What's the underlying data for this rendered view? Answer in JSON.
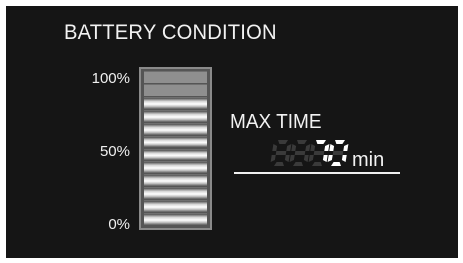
{
  "title": "BATTERY CONDITION",
  "gauge": {
    "tick_100": "100%",
    "tick_50": "50%",
    "tick_0": "0%",
    "level_fraction": 0.82,
    "total_segments": 12,
    "lit_segments": 10
  },
  "max_time": {
    "label": "MAX TIME",
    "value": "70",
    "unit": "min"
  }
}
